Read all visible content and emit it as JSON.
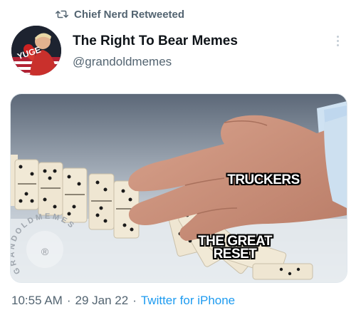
{
  "retweet": {
    "label": "Chief Nerd Retweeted",
    "icon": "retweet-icon"
  },
  "author": {
    "display_name": "The Right To Bear Memes",
    "handle": "@grandoldmemes",
    "avatar_text": "YUGE"
  },
  "media": {
    "captions": {
      "truckers": "TRUCKERS",
      "reset_line1": "THE GREAT",
      "reset_line2": "RESET"
    },
    "watermark": "GRANDOLDMEMES"
  },
  "meta": {
    "time": "10:55 AM",
    "separator": "·",
    "date": "29 Jan 22",
    "source": "Twitter for iPhone"
  },
  "colors": {
    "link": "#1d9bf0",
    "secondary": "#536471",
    "text": "#0f1419"
  }
}
